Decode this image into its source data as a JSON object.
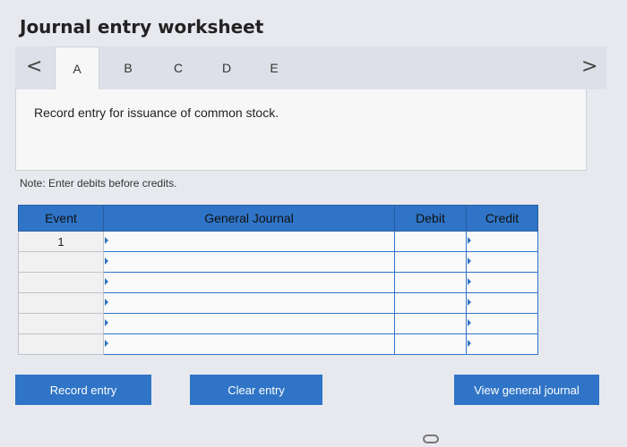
{
  "header": {
    "title": "Journal entry worksheet"
  },
  "tabs": {
    "prev_icon": "chevron-left-icon",
    "next_icon": "chevron-right-icon",
    "prev_glyph": "<",
    "next_glyph": ">",
    "items": [
      {
        "label": "A",
        "active": true
      },
      {
        "label": "B",
        "active": false
      },
      {
        "label": "C",
        "active": false
      },
      {
        "label": "D",
        "active": false
      },
      {
        "label": "E",
        "active": false
      }
    ]
  },
  "instruction": {
    "text": "Record entry for issuance of common stock."
  },
  "note": {
    "text": "Note: Enter debits before credits."
  },
  "journal": {
    "headers": [
      "Event",
      "General Journal",
      "Debit",
      "Credit"
    ],
    "rows": [
      {
        "event": "1",
        "account": "",
        "debit": "",
        "credit": ""
      },
      {
        "event": "",
        "account": "",
        "debit": "",
        "credit": ""
      },
      {
        "event": "",
        "account": "",
        "debit": "",
        "credit": ""
      },
      {
        "event": "",
        "account": "",
        "debit": "",
        "credit": ""
      },
      {
        "event": "",
        "account": "",
        "debit": "",
        "credit": ""
      },
      {
        "event": "",
        "account": "",
        "debit": "",
        "credit": ""
      }
    ]
  },
  "buttons": {
    "record": "Record entry",
    "clear": "Clear entry",
    "view": "View general journal"
  },
  "colors": {
    "accent": "#2f74c6",
    "background": "#e7e9ee",
    "panel": "#f7f7f7"
  }
}
